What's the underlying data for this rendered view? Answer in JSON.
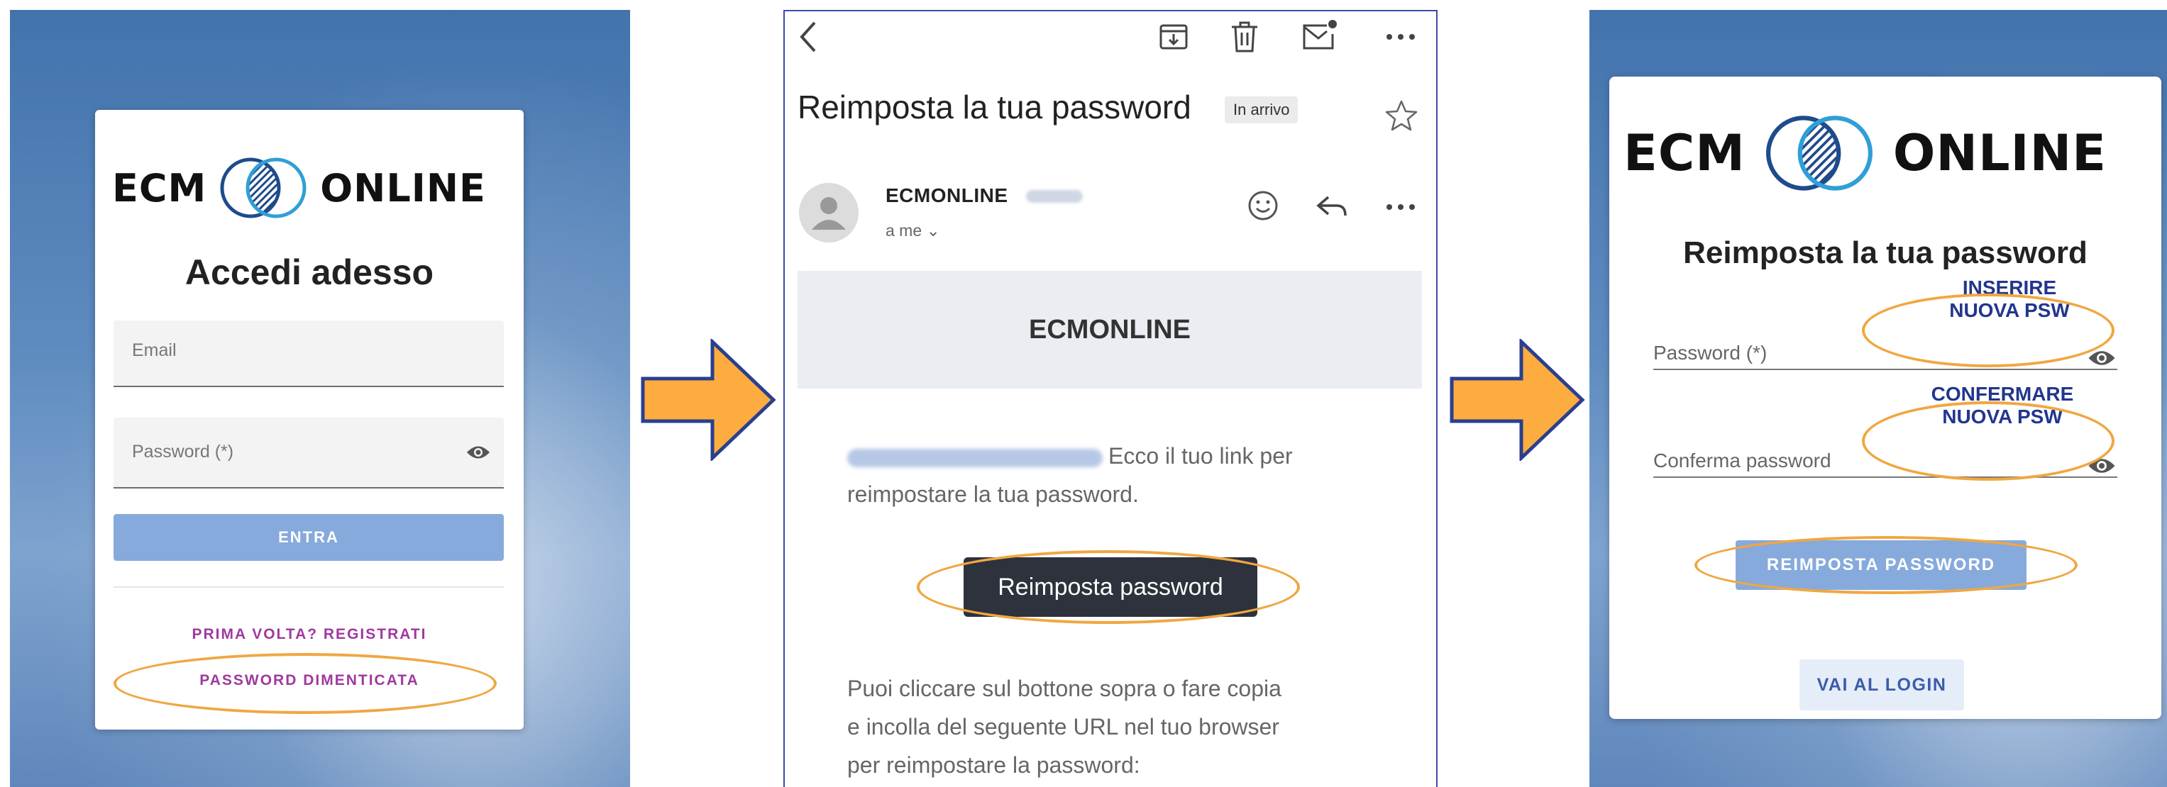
{
  "colors": {
    "arrow_fill": "#fdac3f",
    "arrow_stroke": "#2b3f8f",
    "highlight": "#f0a742",
    "annotation": "#23368f",
    "link": "#a0399f",
    "button_blue": "#86aadb"
  },
  "login": {
    "logo_left": "ECM",
    "logo_right": "ONLINE",
    "title": "Accedi adesso",
    "email_label": "Email",
    "password_label": "Password (*)",
    "submit": "ENTRA",
    "register": "PRIMA VOLTA? REGISTRATI",
    "forgot": "PASSWORD DIMENTICATA"
  },
  "email": {
    "subject": "Reimposta la tua password",
    "badge": "In arrivo",
    "sender": "ECMONLINE",
    "to": "a me ⌄",
    "banner": "ECMONLINE",
    "intro_rest": "Ecco il tuo link per",
    "intro_line2": "reimpostare la tua password.",
    "button": "Reimposta password",
    "body_line1": "Puoi cliccare sul bottone sopra o fare copia",
    "body_line2": "e incolla del seguente URL nel tuo browser",
    "body_line3": "per reimpostare la password:",
    "icons": [
      "back-icon",
      "archive-icon",
      "trash-icon",
      "mark-unread-icon",
      "more-icon",
      "star-icon",
      "emoji-icon",
      "reply-icon"
    ]
  },
  "reset": {
    "logo_left": "ECM",
    "logo_right": "ONLINE",
    "title": "Reimposta la tua password",
    "password_label": "Password (*)",
    "confirm_label": "Conferma password",
    "submit": "REIMPOSTA PASSWORD",
    "back_login": "VAI AL LOGIN",
    "annotation_new_1": "INSERIRE",
    "annotation_new_2": "NUOVA PSW",
    "annotation_confirm_1": "CONFERMARE",
    "annotation_confirm_2": "NUOVA PSW"
  }
}
